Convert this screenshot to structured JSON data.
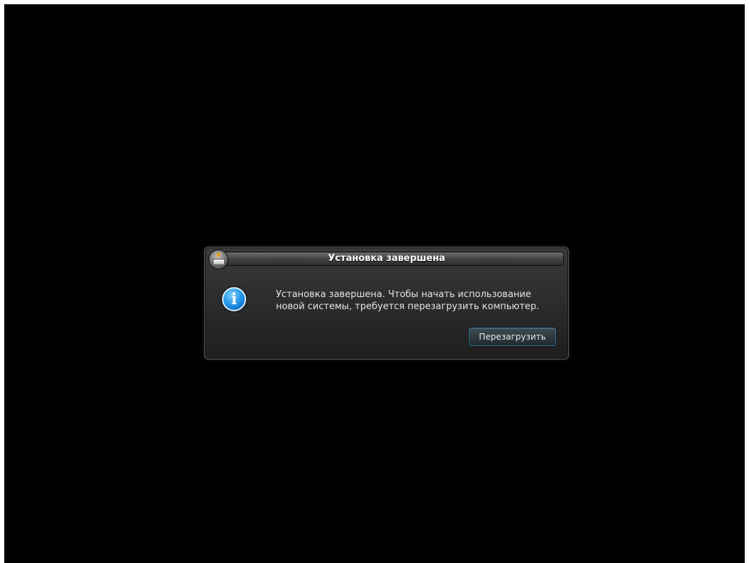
{
  "dialog": {
    "title": "Установка завершена",
    "icon": "info-icon",
    "message_lines": [
      "Установка завершена. Чтобы начать использование",
      "новой системы, требуется перезагрузить компьютер."
    ],
    "reboot_label": "Перезагрузить"
  },
  "colors": {
    "background": "#000000",
    "accent": "#1c8de6",
    "button_border": "#2b6e8e"
  }
}
